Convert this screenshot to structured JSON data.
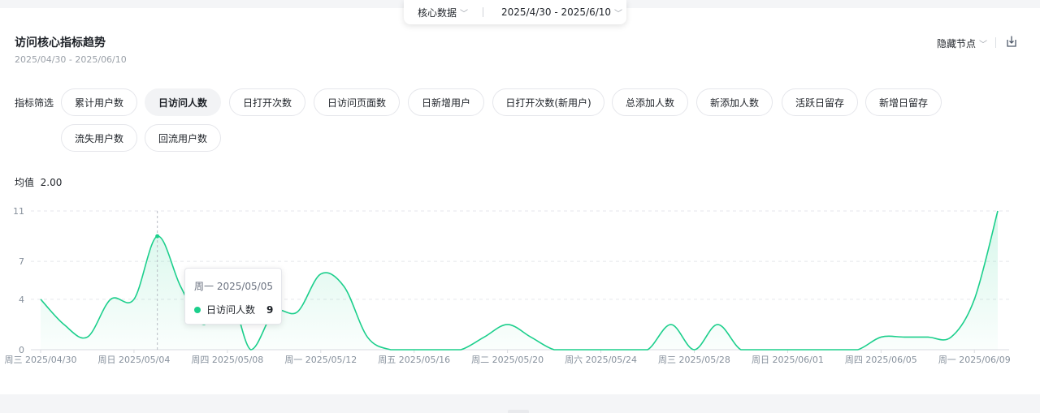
{
  "topbar": {
    "data_type": "核心数据",
    "date_range": "2025/4/30 - 2025/6/10"
  },
  "header": {
    "title": "访问核心指标趋势",
    "date_range": "2025/04/30 - 2025/06/10",
    "hide_nodes_label": "隐藏节点"
  },
  "filters": {
    "label": "指标筛选",
    "chips": [
      "累计用户数",
      "日访问人数",
      "日打开次数",
      "日访问页面数",
      "日新增用户",
      "日打开次数(新用户)",
      "总添加人数",
      "新添加人数",
      "活跃日留存",
      "新增日留存",
      "流失用户数",
      "回流用户数"
    ],
    "active_index": 1
  },
  "average": {
    "label": "均值",
    "value": "2.00"
  },
  "tooltip": {
    "date": "周一 2025/05/05",
    "series": "日访问人数",
    "value": "9"
  },
  "colors": {
    "line": "#1ccf8c",
    "grid": "#e5e6eb",
    "axis_text": "#86909c"
  },
  "chart_data": {
    "type": "area",
    "ylim": [
      0,
      11
    ],
    "yticks": [
      0,
      4,
      7,
      11
    ],
    "grid": true,
    "x_tick_labels": [
      "周三 2025/04/30",
      "周日 2025/05/04",
      "周四 2025/05/08",
      "周一 2025/05/12",
      "周五 2025/05/16",
      "周二 2025/05/20",
      "周六 2025/05/24",
      "周三 2025/05/28",
      "周日 2025/06/01",
      "周四 2025/06/05",
      "周一 2025/06/09"
    ],
    "x": [
      "2025/04/30",
      "2025/05/01",
      "2025/05/02",
      "2025/05/03",
      "2025/05/04",
      "2025/05/05",
      "2025/05/06",
      "2025/05/07",
      "2025/05/08",
      "2025/05/09",
      "2025/05/10",
      "2025/05/11",
      "2025/05/12",
      "2025/05/13",
      "2025/05/14",
      "2025/05/15",
      "2025/05/16",
      "2025/05/17",
      "2025/05/18",
      "2025/05/19",
      "2025/05/20",
      "2025/05/21",
      "2025/05/22",
      "2025/05/23",
      "2025/05/24",
      "2025/05/25",
      "2025/05/26",
      "2025/05/27",
      "2025/05/28",
      "2025/05/29",
      "2025/05/30",
      "2025/05/31",
      "2025/06/01",
      "2025/06/02",
      "2025/06/03",
      "2025/06/04",
      "2025/06/05",
      "2025/06/06",
      "2025/06/07",
      "2025/06/08",
      "2025/06/09",
      "2025/06/10"
    ],
    "series": [
      {
        "name": "日访问人数",
        "values": [
          4,
          2,
          1,
          4,
          4,
          9,
          5,
          2,
          5,
          0,
          3,
          3,
          6,
          5,
          1,
          0,
          0,
          0,
          0,
          1,
          2,
          1,
          0,
          0,
          0,
          0,
          0,
          2,
          0,
          2,
          0,
          0,
          0,
          0,
          0,
          0,
          1,
          1,
          1,
          1,
          4,
          11
        ]
      }
    ],
    "highlight_index": 5
  }
}
